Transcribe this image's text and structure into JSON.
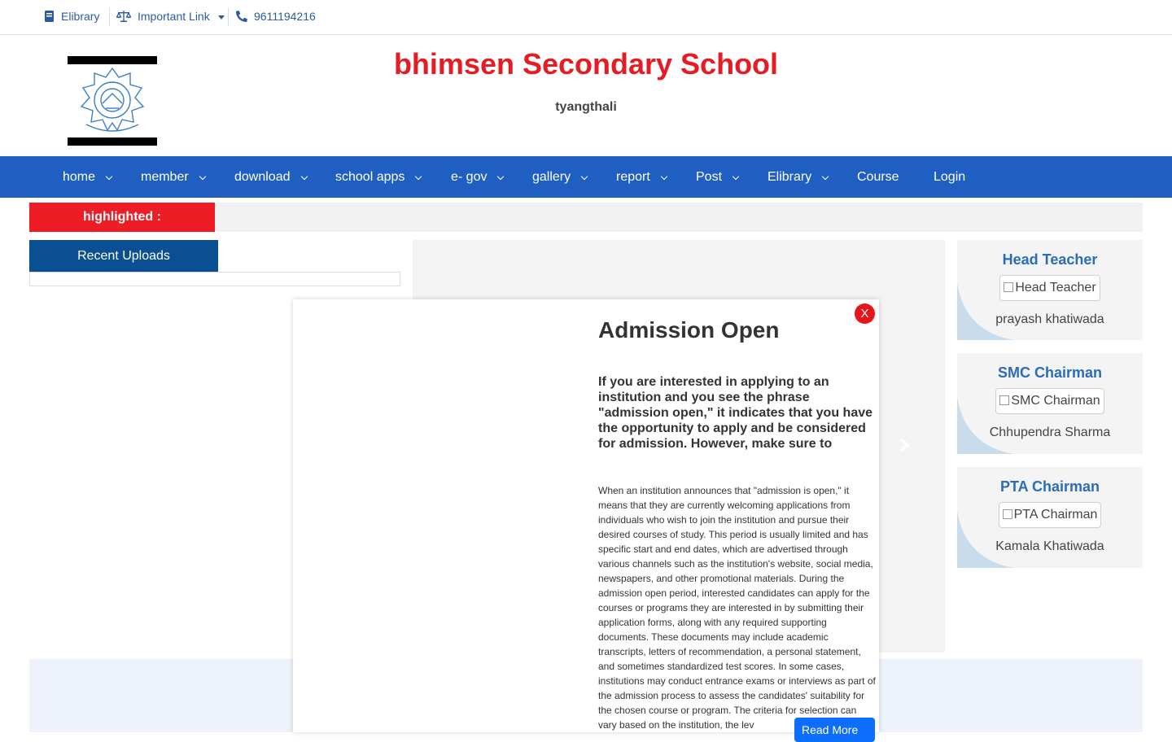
{
  "topbar": {
    "elibrary": "Elibrary",
    "important_link": "Important Link",
    "phone": "9611194216"
  },
  "header": {
    "school_name": "bhimsen Secondary School",
    "place": "tyangthali"
  },
  "nav": [
    {
      "label": "home"
    },
    {
      "label": "member"
    },
    {
      "label": "download"
    },
    {
      "label": "school apps"
    },
    {
      "label": "e- gov"
    },
    {
      "label": "gallery"
    },
    {
      "label": "report"
    },
    {
      "label": "Post"
    },
    {
      "label": "Elibrary"
    },
    {
      "label": "Course"
    },
    {
      "label": "Login"
    }
  ],
  "highlight": {
    "label": "highlighted :"
  },
  "recent_uploads": {
    "title": "Recent Uploads"
  },
  "cards": [
    {
      "title": "Head Teacher",
      "img_alt": "Head Teacher",
      "name": "prayash khatiwada"
    },
    {
      "title": "SMC Chairman",
      "img_alt": "SMC Chairman",
      "name": "Chhupendra Sharma"
    },
    {
      "title": "PTA Chairman",
      "img_alt": "PTA Chairman",
      "name": "Kamala Khatiwada"
    }
  ],
  "modal": {
    "close": "X",
    "title": "Admission Open",
    "lead": "If you are interested in applying to an institution and you see the phrase \"admission open,\" it indicates that you have the opportunity to apply and be considered for admission. However, make sure to",
    "body": "When an institution announces that \"admission is open,\" it means that they are currently welcoming applications from individuals who wish to join the institution and pursue their desired courses of study. This period is usually limited and has specific start and end dates, which are advertised through various channels such as the institution's website, social media, newspapers, and other promotional materials. During the admission open period, interested candidates can apply for the courses or programs they are interested in by submitting their application forms, along with any required supporting documents. These documents may include academic transcripts, letters of recommendation, a personal statement, and sometimes standardized test scores. In some cases, institutions may conduct entrance exams or interviews as part of the admission process to assess the candidates' suitability for the chosen course or program. The criteria for selection can vary based on the institution, the lev",
    "read_more": "Read More"
  },
  "colors": {
    "nav_bg": "#1f5fc2",
    "school_name": "#e51c23",
    "highlight_label_bg": "#ee1c25",
    "recent_uploads_bg": "#0b4f93",
    "card_title": "#2b6cb8",
    "read_more_bg": "#0d6efd"
  },
  "icons": {
    "elibrary": "book-icon",
    "important_link": "scale-icon",
    "phone": "phone-icon",
    "slider_next": "chevron-right-icon"
  }
}
